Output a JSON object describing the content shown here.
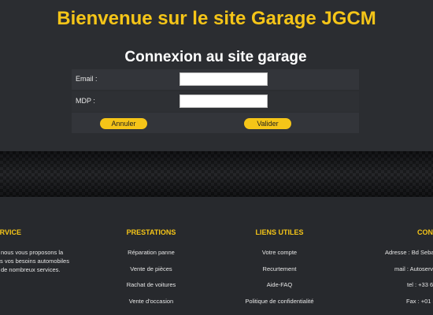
{
  "header": {
    "site_title": "Bienvenue sur le site Garage JGCM",
    "login_title": "Connexion au site garage"
  },
  "login": {
    "email_label": "Email :",
    "email_value": "",
    "password_label": "MDP :",
    "password_value": "",
    "cancel_label": "Annuler",
    "submit_label": "Valider"
  },
  "footer": {
    "service": {
      "title": "ERVICE",
      "lines": [
        "nous vous proposons la",
        "s vos besoins automobiles",
        "de nombreux services."
      ]
    },
    "prestations": {
      "title": "PRESTATIONS",
      "items": [
        "Réparation panne",
        "Vente de pièces",
        "Rachat de voitures",
        "Vente d'occasion"
      ]
    },
    "liens": {
      "title": "LIENS UTILES",
      "items": [
        "Votre compte",
        "Recurtement",
        "Aide-FAQ",
        "Politique de confidentialité"
      ]
    },
    "contact": {
      "title": "CON",
      "items": [
        "Adresse : Bd Sebas",
        "mail : Autoserv",
        "tel : +33 6",
        "Fax : +01 3"
      ]
    }
  },
  "colors": {
    "accent": "#f5c518",
    "background": "#2b2d31",
    "footer_background": "#27292d"
  }
}
